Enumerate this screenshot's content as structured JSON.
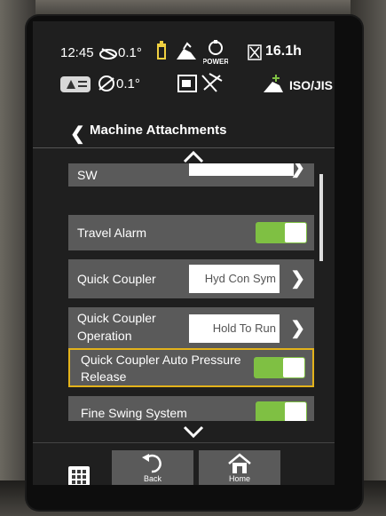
{
  "status": {
    "time": "12:45",
    "tilt_top": "0.1°",
    "power_label": "POWER",
    "hour_meter": "16.1h",
    "tilt_bottom": "0.1°",
    "standard": "ISO/JIS"
  },
  "header": {
    "title": "Machine Attachments"
  },
  "settings": [
    {
      "label": "SW",
      "type": "select",
      "value": ""
    },
    {
      "label": "Travel Alarm",
      "type": "toggle",
      "on": true
    },
    {
      "label": "Quick Coupler",
      "type": "select",
      "value": "Hyd Con Sym"
    },
    {
      "label": "Quick Coupler",
      "label2": "Operation",
      "type": "select",
      "value": "Hold To Run"
    },
    {
      "label": "Quick Coupler Auto Pressure",
      "label2": "Release",
      "type": "toggle",
      "on": true
    },
    {
      "label": "Fine Swing System",
      "type": "toggle",
      "on": true
    }
  ],
  "footer": {
    "back_label": "Back",
    "home_label": "Home"
  },
  "colors": {
    "toggle_on": "#7fc043",
    "highlight": "#e3b21b",
    "row_bg": "#5a5a5a"
  },
  "icons": [
    "tilt-icon",
    "battery-icon",
    "machine-icon",
    "power-icon",
    "hourglass-icon",
    "warning-icon",
    "camera-icon",
    "operator-icon",
    "chevron-up-icon",
    "chevron-down-icon",
    "back-arrow-icon",
    "home-icon",
    "grid-icon"
  ]
}
